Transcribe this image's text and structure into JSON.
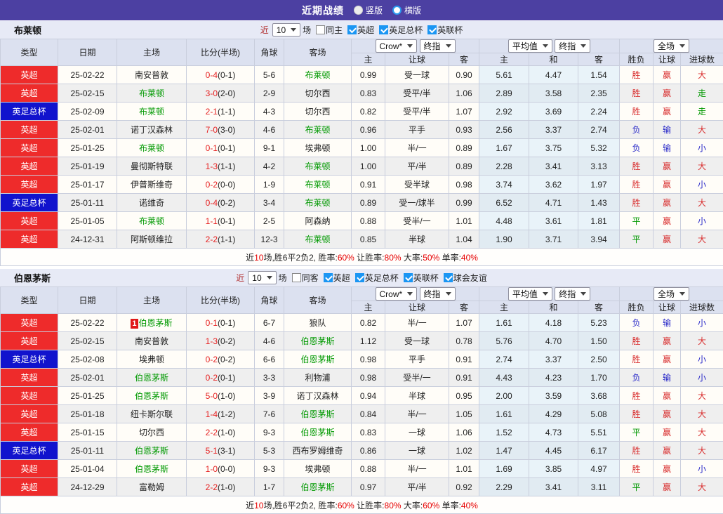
{
  "topbar": {
    "title": "近期战绩",
    "options": [
      {
        "label": "竖版",
        "selected": true
      },
      {
        "label": "横版",
        "selected": false
      }
    ]
  },
  "controls": {
    "near": "近",
    "games": "场",
    "crow": "Crow*",
    "final_idx": "终指",
    "average": "平均值",
    "full_court": "全场"
  },
  "table_header": {
    "type": "类型",
    "date": "日期",
    "home": "主场",
    "score": "比分(半场)",
    "corner": "角球",
    "away": "客场",
    "home_odds": "主",
    "handicap": "让球",
    "away_odds": "客",
    "avg_home": "主",
    "avg_draw": "和",
    "avg_away": "客",
    "wdl": "胜负",
    "hcp_result": "让球",
    "goals": "进球数"
  },
  "league_colors": {
    "英超": "#ee2b2b",
    "英足总杯": "#1113cd",
    "英联杯": "#1113cd"
  },
  "colors": {
    "topbar_bg": "#4c40a2",
    "section_bg": "#e7eaf6",
    "header_bg": "#dce1f0",
    "stripe_even": "#efefef",
    "stripe_odd": "#fffdf8",
    "avg_col_bg": "#e9f3f9",
    "win_red": "#d93030",
    "lose_blue": "#2a2ac8",
    "draw_green": "#009900",
    "team_green": "#009900",
    "score_red": "#e62222",
    "checkbox_blue": "#1b96f3"
  },
  "sections": [
    {
      "team": "布莱顿",
      "filters": {
        "near_count": "10",
        "same_side": "同主",
        "same_checked": false,
        "leagues": [
          {
            "label": "英超",
            "checked": true
          },
          {
            "label": "英足总杯",
            "checked": true
          },
          {
            "label": "英联杯",
            "checked": true
          }
        ]
      },
      "rows": [
        {
          "type": "英超",
          "date": "25-02-22",
          "home": "南安普敦",
          "score": "0-4",
          "half": "(0-1)",
          "corner": "5-6",
          "away": "布莱顿",
          "o1": "0.99",
          "hcp": "受一球",
          "o2": "0.90",
          "a1": "5.61",
          "a2": "4.47",
          "a3": "1.54",
          "r1": "胜",
          "r2": "赢",
          "r3": "大"
        },
        {
          "type": "英超",
          "date": "25-02-15",
          "home": "布莱顿",
          "score": "3-0",
          "half": "(2-0)",
          "corner": "2-9",
          "away": "切尔西",
          "o1": "0.83",
          "hcp": "受平/半",
          "o2": "1.06",
          "a1": "2.89",
          "a2": "3.58",
          "a3": "2.35",
          "r1": "胜",
          "r2": "赢",
          "r3": "走"
        },
        {
          "type": "英足总杯",
          "date": "25-02-09",
          "home": "布莱顿",
          "score": "2-1",
          "half": "(1-1)",
          "corner": "4-3",
          "away": "切尔西",
          "o1": "0.82",
          "hcp": "受平/半",
          "o2": "1.07",
          "a1": "2.92",
          "a2": "3.69",
          "a3": "2.24",
          "r1": "胜",
          "r2": "赢",
          "r3": "走"
        },
        {
          "type": "英超",
          "date": "25-02-01",
          "home": "诺丁汉森林",
          "score": "7-0",
          "half": "(3-0)",
          "corner": "4-6",
          "away": "布莱顿",
          "o1": "0.96",
          "hcp": "平手",
          "o2": "0.93",
          "a1": "2.56",
          "a2": "3.37",
          "a3": "2.74",
          "r1": "负",
          "r2": "输",
          "r3": "大"
        },
        {
          "type": "英超",
          "date": "25-01-25",
          "home": "布莱顿",
          "score": "0-1",
          "half": "(0-1)",
          "corner": "9-1",
          "away": "埃弗顿",
          "o1": "1.00",
          "hcp": "半/一",
          "o2": "0.89",
          "a1": "1.67",
          "a2": "3.75",
          "a3": "5.32",
          "r1": "负",
          "r2": "输",
          "r3": "小"
        },
        {
          "type": "英超",
          "date": "25-01-19",
          "home": "曼彻斯特联",
          "score": "1-3",
          "half": "(1-1)",
          "corner": "4-2",
          "away": "布莱顿",
          "o1": "1.00",
          "hcp": "平/半",
          "o2": "0.89",
          "a1": "2.28",
          "a2": "3.41",
          "a3": "3.13",
          "r1": "胜",
          "r2": "赢",
          "r3": "大"
        },
        {
          "type": "英超",
          "date": "25-01-17",
          "home": "伊普斯维奇",
          "score": "0-2",
          "half": "(0-0)",
          "corner": "1-9",
          "away": "布莱顿",
          "o1": "0.91",
          "hcp": "受半球",
          "o2": "0.98",
          "a1": "3.74",
          "a2": "3.62",
          "a3": "1.97",
          "r1": "胜",
          "r2": "赢",
          "r3": "小"
        },
        {
          "type": "英足总杯",
          "date": "25-01-11",
          "home": "诺维奇",
          "score": "0-4",
          "half": "(0-2)",
          "corner": "3-4",
          "away": "布莱顿",
          "o1": "0.89",
          "hcp": "受一/球半",
          "o2": "0.99",
          "a1": "6.52",
          "a2": "4.71",
          "a3": "1.43",
          "r1": "胜",
          "r2": "赢",
          "r3": "大"
        },
        {
          "type": "英超",
          "date": "25-01-05",
          "home": "布莱顿",
          "score": "1-1",
          "half": "(0-1)",
          "corner": "2-5",
          "away": "阿森纳",
          "o1": "0.88",
          "hcp": "受半/一",
          "o2": "1.01",
          "a1": "4.48",
          "a2": "3.61",
          "a3": "1.81",
          "r1": "平",
          "r2": "赢",
          "r3": "小"
        },
        {
          "type": "英超",
          "date": "24-12-31",
          "home": "阿斯顿维拉",
          "score": "2-2",
          "half": "(1-1)",
          "corner": "12-3",
          "away": "布莱顿",
          "o1": "0.85",
          "hcp": "半球",
          "o2": "1.04",
          "a1": "1.90",
          "a2": "3.71",
          "a3": "3.94",
          "r1": "平",
          "r2": "赢",
          "r3": "大"
        }
      ],
      "summary": [
        {
          "t": "近"
        },
        {
          "t": "10",
          "red": true
        },
        {
          "t": "场,胜6平2负2, 胜率:"
        },
        {
          "t": "60%",
          "red": true
        },
        {
          "t": " 让胜率:"
        },
        {
          "t": "80%",
          "red": true
        },
        {
          "t": " 大率:"
        },
        {
          "t": "50%",
          "red": true
        },
        {
          "t": " 单率:"
        },
        {
          "t": "40%",
          "red": true
        }
      ]
    },
    {
      "team": "伯恩茅斯",
      "filters": {
        "near_count": "10",
        "same_side": "同客",
        "same_checked": false,
        "leagues": [
          {
            "label": "英超",
            "checked": true
          },
          {
            "label": "英足总杯",
            "checked": true
          },
          {
            "label": "英联杯",
            "checked": true
          },
          {
            "label": "球会友谊",
            "checked": true
          }
        ]
      },
      "rows": [
        {
          "type": "英超",
          "date": "25-02-22",
          "home": "伯恩茅斯",
          "home_badge": "1",
          "score": "0-1",
          "half": "(0-1)",
          "corner": "6-7",
          "away": "狼队",
          "o1": "0.82",
          "hcp": "半/一",
          "o2": "1.07",
          "a1": "1.61",
          "a2": "4.18",
          "a3": "5.23",
          "r1": "负",
          "r2": "输",
          "r3": "小"
        },
        {
          "type": "英超",
          "date": "25-02-15",
          "home": "南安普敦",
          "score": "1-3",
          "half": "(0-2)",
          "corner": "4-6",
          "away": "伯恩茅斯",
          "o1": "1.12",
          "hcp": "受一球",
          "o2": "0.78",
          "a1": "5.76",
          "a2": "4.70",
          "a3": "1.50",
          "r1": "胜",
          "r2": "赢",
          "r3": "大"
        },
        {
          "type": "英足总杯",
          "date": "25-02-08",
          "home": "埃弗顿",
          "score": "0-2",
          "half": "(0-2)",
          "corner": "6-6",
          "away": "伯恩茅斯",
          "o1": "0.98",
          "hcp": "平手",
          "o2": "0.91",
          "a1": "2.74",
          "a2": "3.37",
          "a3": "2.50",
          "r1": "胜",
          "r2": "赢",
          "r3": "小"
        },
        {
          "type": "英超",
          "date": "25-02-01",
          "home": "伯恩茅斯",
          "score": "0-2",
          "half": "(0-1)",
          "corner": "3-3",
          "away": "利物浦",
          "o1": "0.98",
          "hcp": "受半/一",
          "o2": "0.91",
          "a1": "4.43",
          "a2": "4.23",
          "a3": "1.70",
          "r1": "负",
          "r2": "输",
          "r3": "小"
        },
        {
          "type": "英超",
          "date": "25-01-25",
          "home": "伯恩茅斯",
          "score": "5-0",
          "half": "(1-0)",
          "corner": "3-9",
          "away": "诺丁汉森林",
          "o1": "0.94",
          "hcp": "半球",
          "o2": "0.95",
          "a1": "2.00",
          "a2": "3.59",
          "a3": "3.68",
          "r1": "胜",
          "r2": "赢",
          "r3": "大"
        },
        {
          "type": "英超",
          "date": "25-01-18",
          "home": "纽卡斯尔联",
          "score": "1-4",
          "half": "(1-2)",
          "corner": "7-6",
          "away": "伯恩茅斯",
          "o1": "0.84",
          "hcp": "半/一",
          "o2": "1.05",
          "a1": "1.61",
          "a2": "4.29",
          "a3": "5.08",
          "r1": "胜",
          "r2": "赢",
          "r3": "大"
        },
        {
          "type": "英超",
          "date": "25-01-15",
          "home": "切尔西",
          "score": "2-2",
          "half": "(1-0)",
          "corner": "9-3",
          "away": "伯恩茅斯",
          "o1": "0.83",
          "hcp": "一球",
          "o2": "1.06",
          "a1": "1.52",
          "a2": "4.73",
          "a3": "5.51",
          "r1": "平",
          "r2": "赢",
          "r3": "大"
        },
        {
          "type": "英足总杯",
          "date": "25-01-11",
          "home": "伯恩茅斯",
          "score": "5-1",
          "half": "(3-1)",
          "corner": "5-3",
          "away": "西布罗姆维奇",
          "o1": "0.86",
          "hcp": "一球",
          "o2": "1.02",
          "a1": "1.47",
          "a2": "4.45",
          "a3": "6.17",
          "r1": "胜",
          "r2": "赢",
          "r3": "大"
        },
        {
          "type": "英超",
          "date": "25-01-04",
          "home": "伯恩茅斯",
          "score": "1-0",
          "half": "(0-0)",
          "corner": "9-3",
          "away": "埃弗顿",
          "o1": "0.88",
          "hcp": "半/一",
          "o2": "1.01",
          "a1": "1.69",
          "a2": "3.85",
          "a3": "4.97",
          "r1": "胜",
          "r2": "赢",
          "r3": "小"
        },
        {
          "type": "英超",
          "date": "24-12-29",
          "home": "富勒姆",
          "score": "2-2",
          "half": "(1-0)",
          "corner": "1-7",
          "away": "伯恩茅斯",
          "o1": "0.97",
          "hcp": "平/半",
          "o2": "0.92",
          "a1": "2.29",
          "a2": "3.41",
          "a3": "3.11",
          "r1": "平",
          "r2": "赢",
          "r3": "大"
        }
      ],
      "summary": [
        {
          "t": "近"
        },
        {
          "t": "10",
          "red": true
        },
        {
          "t": "场,胜6平2负2, 胜率:"
        },
        {
          "t": "60%",
          "red": true
        },
        {
          "t": " 让胜率:"
        },
        {
          "t": "80%",
          "red": true
        },
        {
          "t": " 大率:"
        },
        {
          "t": "60%",
          "red": true
        },
        {
          "t": " 单率:"
        },
        {
          "t": "40%",
          "red": true
        }
      ]
    }
  ]
}
